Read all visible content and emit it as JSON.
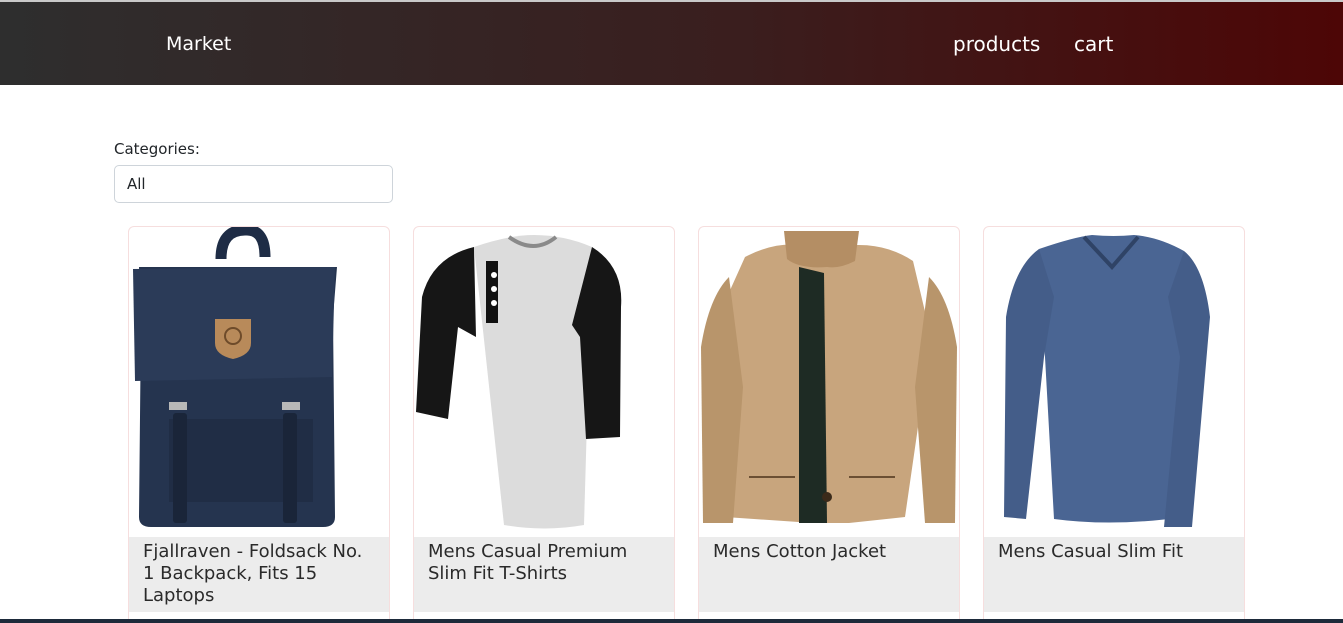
{
  "nav": {
    "brand": "Market",
    "links": [
      "products",
      "cart"
    ],
    "gradient": [
      "#2e2e2e",
      "#4d0606"
    ]
  },
  "filter": {
    "label": "Categories:",
    "selected": "All"
  },
  "products": [
    {
      "title": "Fjallraven - Foldsack No. 1 Backpack, Fits 15 Laptops",
      "icon": "backpack-image"
    },
    {
      "title": "Mens Casual Premium Slim Fit T-Shirts",
      "icon": "raglan-tshirt-image"
    },
    {
      "title": "Mens Cotton Jacket",
      "icon": "jacket-image"
    },
    {
      "title": "Mens Casual Slim Fit",
      "icon": "long-sleeve-shirt-image"
    }
  ]
}
